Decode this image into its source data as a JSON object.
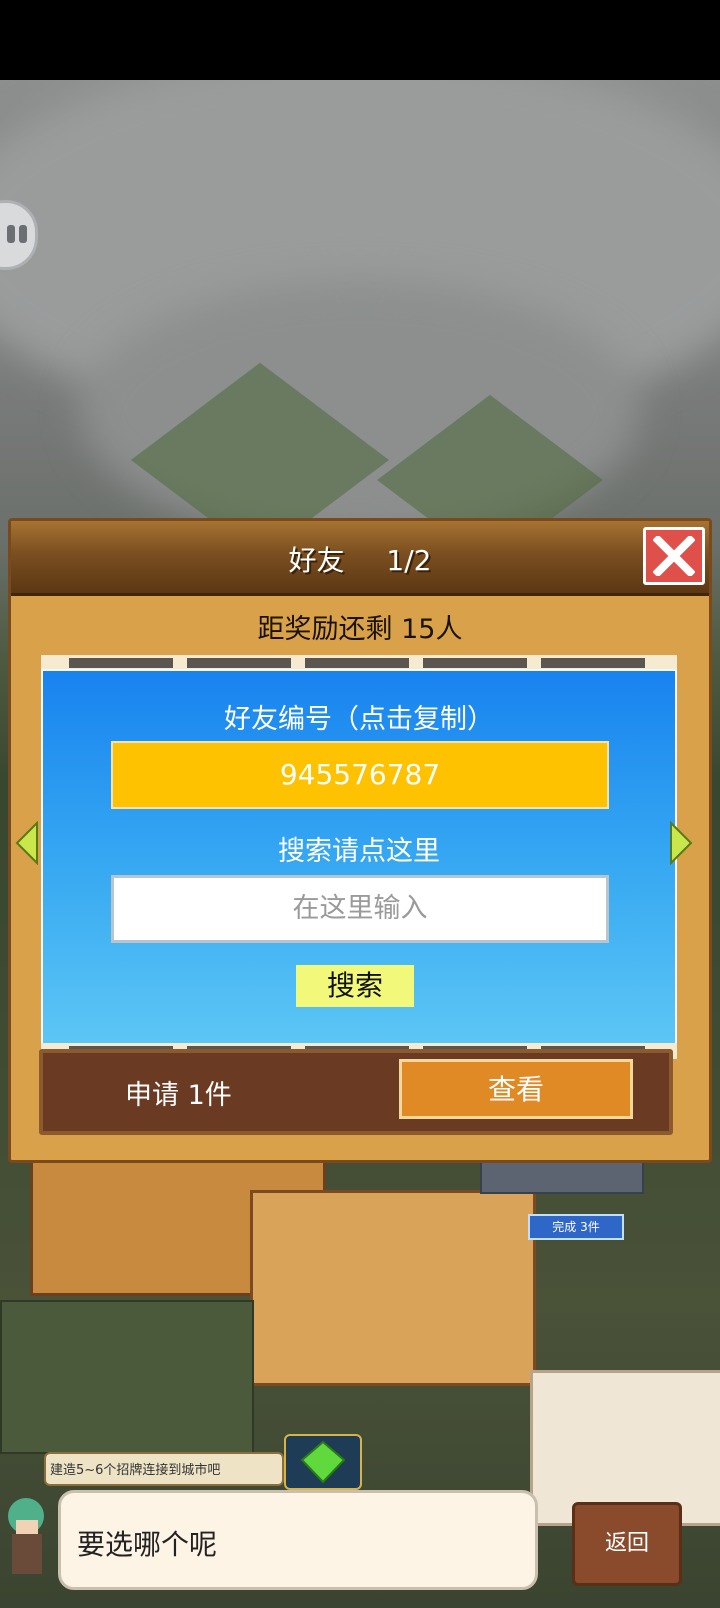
{
  "dialog": {
    "title": "好友",
    "page": "1/2",
    "reward_status": "距奖励还剩 15人",
    "friend_id_label": "好友编号（点击复制）",
    "friend_id_value": "945576787",
    "search_label": "搜索请点这里",
    "search_placeholder": "在这里输入",
    "search_button": "搜索",
    "requests_text": "申请 1件",
    "view_button": "查看"
  },
  "game": {
    "complete_badge": "完成 3件",
    "hint_banner": "建造5~6个招牌连接到城市吧",
    "speech_text": "要选哪个呢",
    "back_button": "返回"
  },
  "colors": {
    "panel_blue": "#1883ef",
    "id_yellow": "#fec200",
    "close_red": "#e0504a",
    "view_orange": "#e08a25"
  },
  "icons": [
    "close-icon",
    "left-arrow-icon",
    "right-arrow-icon",
    "gem-icon",
    "chat-bubble-icon"
  ]
}
